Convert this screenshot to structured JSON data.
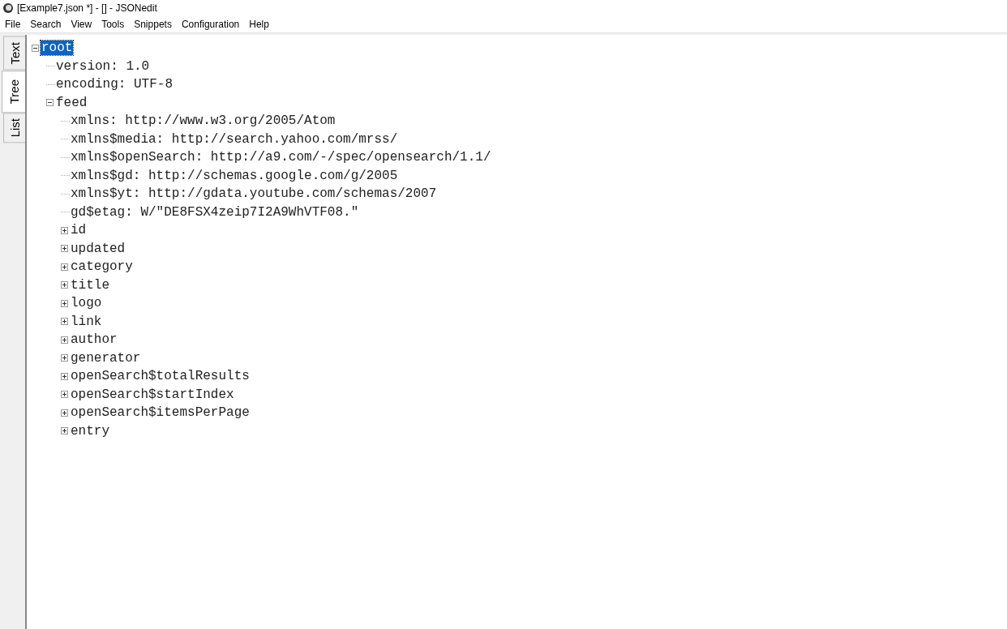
{
  "window": {
    "title": "[Example7.json *] - [] - JSONedit"
  },
  "menu": [
    "File",
    "Search",
    "View",
    "Tools",
    "Snippets",
    "Configuration",
    "Help"
  ],
  "tabs": [
    {
      "label": "Text",
      "selected": false
    },
    {
      "label": "Tree",
      "selected": true
    },
    {
      "label": "List",
      "selected": false
    }
  ],
  "tree": [
    {
      "label": "root",
      "kind": "branch",
      "expanded": true,
      "selected": true,
      "children": [
        {
          "label": "version: 1.0",
          "kind": "leaf",
          "selected": false
        },
        {
          "label": "encoding: UTF-8",
          "kind": "leaf",
          "selected": false
        },
        {
          "label": "feed",
          "kind": "branch",
          "expanded": true,
          "selected": false,
          "children": [
            {
              "label": "xmlns: http://www.w3.org/2005/Atom",
              "kind": "leaf",
              "selected": false
            },
            {
              "label": "xmlns$media: http://search.yahoo.com/mrss/",
              "kind": "leaf",
              "selected": false
            },
            {
              "label": "xmlns$openSearch: http://a9.com/-/spec/opensearch/1.1/",
              "kind": "leaf",
              "selected": false
            },
            {
              "label": "xmlns$gd: http://schemas.google.com/g/2005",
              "kind": "leaf",
              "selected": false
            },
            {
              "label": "xmlns$yt: http://gdata.youtube.com/schemas/2007",
              "kind": "leaf",
              "selected": false
            },
            {
              "label": "gd$etag: W/\"DE8FSX4zeip7I2A9WhVTF08.\"",
              "kind": "leaf",
              "selected": false
            },
            {
              "label": "id",
              "kind": "branch",
              "expanded": false,
              "selected": false
            },
            {
              "label": "updated",
              "kind": "branch",
              "expanded": false,
              "selected": false
            },
            {
              "label": "category",
              "kind": "branch",
              "expanded": false,
              "selected": false
            },
            {
              "label": "title",
              "kind": "branch",
              "expanded": false,
              "selected": false
            },
            {
              "label": "logo",
              "kind": "branch",
              "expanded": false,
              "selected": false
            },
            {
              "label": "link",
              "kind": "branch",
              "expanded": false,
              "selected": false
            },
            {
              "label": "author",
              "kind": "branch",
              "expanded": false,
              "selected": false
            },
            {
              "label": "generator",
              "kind": "branch",
              "expanded": false,
              "selected": false
            },
            {
              "label": "openSearch$totalResults",
              "kind": "branch",
              "expanded": false,
              "selected": false
            },
            {
              "label": "openSearch$startIndex",
              "kind": "branch",
              "expanded": false,
              "selected": false
            },
            {
              "label": "openSearch$itemsPerPage",
              "kind": "branch",
              "expanded": false,
              "selected": false
            },
            {
              "label": "entry",
              "kind": "branch",
              "expanded": false,
              "selected": false
            }
          ]
        }
      ]
    }
  ]
}
